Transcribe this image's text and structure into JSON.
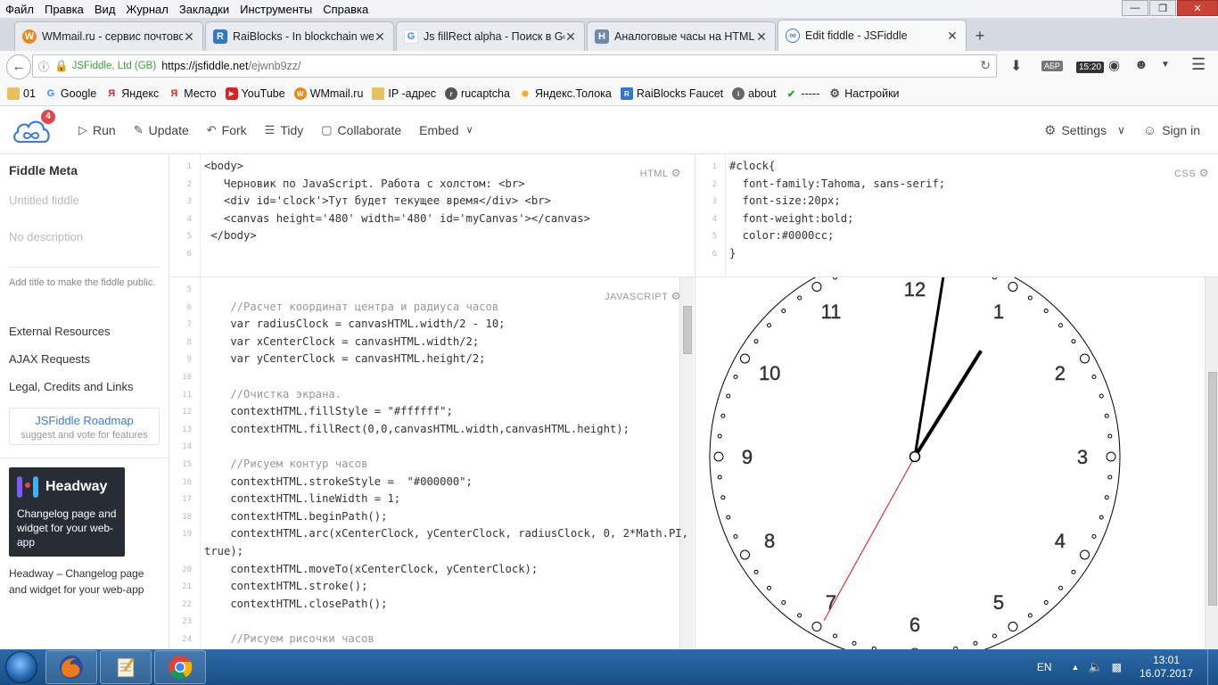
{
  "browser": {
    "menu": [
      "Файл",
      "Правка",
      "Вид",
      "Журнал",
      "Закладки",
      "Инструменты",
      "Справка"
    ],
    "tabs": [
      {
        "title": "WMmail.ru - сервис почтово",
        "icon": "wmmail-icon",
        "color": "#e88a1a"
      },
      {
        "title": "RaiBlocks - In blockchain we",
        "icon": "raiblocks-icon",
        "color": "#2f77d1"
      },
      {
        "title": "Js fillRect alpha - Поиск в Go",
        "icon": "google-icon",
        "color": "#4285f4"
      },
      {
        "title": "Аналоговые часы на HTML",
        "icon": "habr-icon",
        "color": "#6d8ba7"
      },
      {
        "title": "Edit fiddle - JSFiddle",
        "icon": "jsfiddle-icon",
        "color": "#3b7dd8"
      }
    ],
    "url": {
      "org": "JSFiddle, Ltd (GB)",
      "host": "https://jsfiddle.net",
      "path": "/ejwnb9zz/"
    },
    "time_badge": "15:20",
    "lang_badge": "АБР",
    "bookmarks": [
      {
        "label": "01",
        "icon": "folder-icon",
        "color": "#e8c15a"
      },
      {
        "label": "Google",
        "icon": "google-icon",
        "color": "#4285f4"
      },
      {
        "label": "Яндекс",
        "icon": "yandex-icon",
        "color": "#e22"
      },
      {
        "label": "Место",
        "icon": "yandex-icon",
        "color": "#e22"
      },
      {
        "label": "YouTube",
        "icon": "youtube-icon",
        "color": "#e02020"
      },
      {
        "label": "WMmail.ru",
        "icon": "wmmail-icon",
        "color": "#e88a1a"
      },
      {
        "label": "IP -адрес",
        "icon": "folder-icon",
        "color": "#e8c15a"
      },
      {
        "label": "rucaptcha",
        "icon": "rucaptcha-icon",
        "color": "#555"
      },
      {
        "label": "Яндекс.Толока",
        "icon": "toloka-icon",
        "color": "#f5a623"
      },
      {
        "label": "RaiBlocks Faucet",
        "icon": "raiblocks-icon",
        "color": "#2f77d1"
      },
      {
        "label": "about",
        "icon": "about-icon",
        "color": "#666"
      },
      {
        "label": "-----",
        "icon": "shield-icon",
        "color": "#2a9d3a"
      },
      {
        "label": "Настройки",
        "icon": "gear-icon",
        "color": "#555"
      }
    ]
  },
  "jsfiddle": {
    "badge_count": "4",
    "actions": [
      "Run",
      "Update",
      "Fork",
      "Tidy",
      "Collaborate",
      "Embed"
    ],
    "settings": "Settings",
    "signin": "Sign in",
    "sidebar": {
      "title": "Fiddle Meta",
      "title_placeholder": "Untitled fiddle",
      "desc_placeholder": "No description",
      "hint": "Add title to make the fiddle public.",
      "links": [
        "External Resources",
        "AJAX Requests",
        "Legal, Credits and Links"
      ],
      "roadmap_title": "JSFiddle Roadmap",
      "roadmap_sub": "suggest and vote for features",
      "headway_brand": "Headway",
      "headway_text": "Changelog page and widget for your web-app",
      "headway_caption": "Headway – Changelog page and widget for your web-app"
    },
    "labels": {
      "html": "HTML",
      "css": "CSS",
      "js": "JAVASCRIPT"
    },
    "html_lines": [
      "<body>",
      "   Черновик по JavaScript. Работа с холстом: <br>",
      "   <div id='clock'>Тут будет текущее время</div> <br>",
      "   <canvas height='480' width='480' id='myCanvas'></canvas>",
      " </body>",
      ""
    ],
    "html_numbers": [
      "1",
      "2",
      "3",
      "4",
      "5",
      "6"
    ],
    "css_lines": [
      "#clock{",
      "  font-family:Tahoma, sans-serif;",
      "  font-size:20px;",
      "  font-weight:bold;",
      "  color:#0000cc;",
      "}"
    ],
    "css_numbers": [
      "1",
      "2",
      "3",
      "4",
      "5",
      "6"
    ],
    "js_lines": [
      "",
      "    //Расчет координат центра и радиуса часов",
      "    var radiusClock = canvasHTML.width/2 - 10;",
      "    var xCenterClock = canvasHTML.width/2;",
      "    var yCenterClock = canvasHTML.height/2;",
      "",
      "    //Очистка экрана.",
      "    contextHTML.fillStyle = \"#ffffff\";",
      "    contextHTML.fillRect(0,0,canvasHTML.width,canvasHTML.height);",
      "",
      "    //Рисуем контур часов",
      "    contextHTML.strokeStyle =  \"#000000\";",
      "    contextHTML.lineWidth = 1;",
      "    contextHTML.beginPath();",
      "    contextHTML.arc(xCenterClock, yCenterClock, radiusClock, 0, 2*Math.PI,",
      "true);",
      "    contextHTML.moveTo(xCenterClock, yCenterClock);",
      "    contextHTML.stroke();",
      "    contextHTML.closePath();",
      "",
      "    //Рисуем рисочки часов"
    ],
    "js_numbers": [
      "5",
      "6",
      "7",
      "8",
      "9",
      "10",
      "11",
      "12",
      "13",
      "14",
      "15",
      "16",
      "17",
      "18",
      "19",
      "",
      "20",
      "21",
      "22",
      "23",
      "24"
    ],
    "clock_numbers": [
      "12",
      "1",
      "2",
      "3",
      "4",
      "5",
      "6",
      "7",
      "8",
      "9",
      "10",
      "11"
    ]
  },
  "taskbar": {
    "lang": "EN",
    "time": "13:01",
    "date": "16.07.2017"
  }
}
